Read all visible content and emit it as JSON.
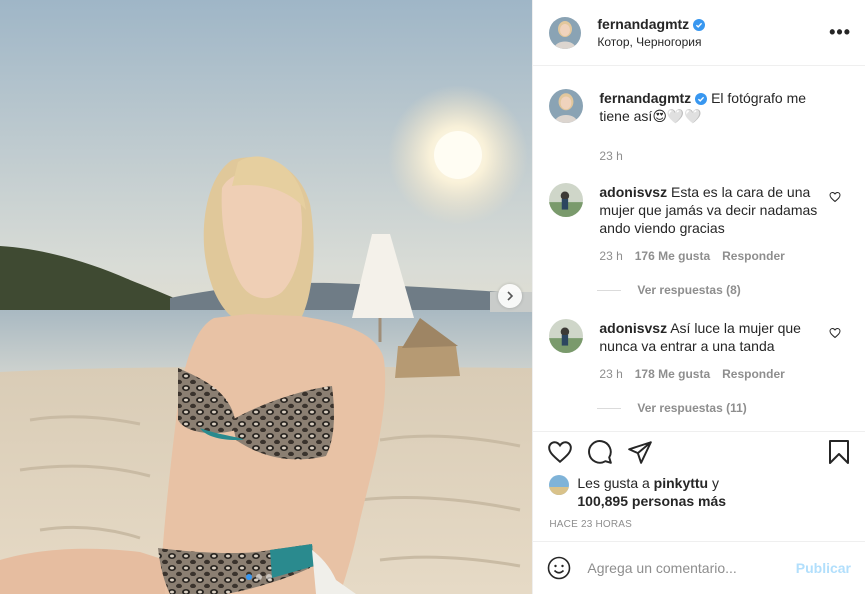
{
  "header": {
    "username": "fernandagmtz",
    "location": "Котор, Черногория",
    "more_label": "•••"
  },
  "caption": {
    "username": "fernandagmtz",
    "text": "El fotógrafo me tiene así😍🤍🤍",
    "time": "23 h"
  },
  "comments": [
    {
      "username": "adonisvsz",
      "text": "Esta es la cara de una mujer que jamás va decir nadamas ando viendo gracias",
      "time": "23 h",
      "likes": "176 Me gusta",
      "reply": "Responder",
      "view_replies": "Ver respuestas (8)"
    },
    {
      "username": "adonisvsz",
      "text": "Así luce la mujer que nunca va entrar a una tanda",
      "time": "23 h",
      "likes": "178 Me gusta",
      "reply": "Responder",
      "view_replies": "Ver respuestas (11)"
    }
  ],
  "likes": {
    "prefix": "Les gusta a",
    "user": "pinkyttu",
    "joiner": "y",
    "count": "100,895 personas más"
  },
  "timestamp": "HACE 23 HORAS",
  "add_comment": {
    "placeholder": "Agrega un comentario...",
    "publish": "Publicar"
  },
  "carousel": {
    "total": 3,
    "active": 0
  },
  "colors": {
    "verified": "#3897f0",
    "accent": "#3897f0",
    "publish_disabled": "#b2dffc"
  }
}
